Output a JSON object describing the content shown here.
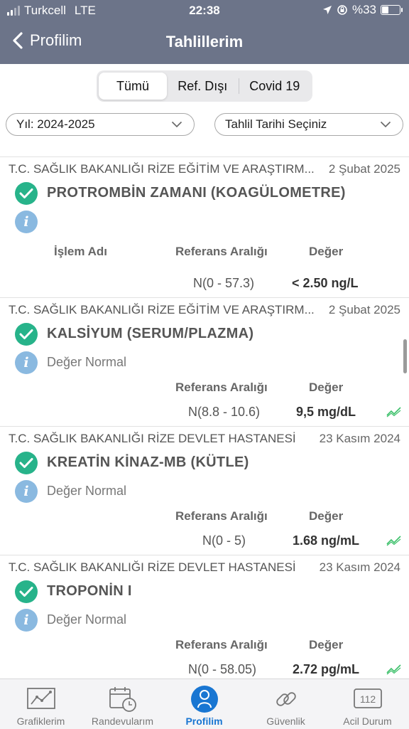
{
  "status_bar": {
    "carrier": "Turkcell",
    "network": "LTE",
    "time": "22:38",
    "battery": "%33",
    "battery_level": 0.33
  },
  "nav": {
    "back_label": "Profilim",
    "title": "Tahlillerim"
  },
  "segments": [
    "Tümü",
    "Ref. Dışı",
    "Covid 19"
  ],
  "filters": {
    "year": "Yıl: 2024-2025",
    "date": "Tahlil Tarihi Seçiniz"
  },
  "columns": {
    "name": "İşlem Adı",
    "range": "Referans Aralığı",
    "value": "Değer"
  },
  "results": [
    {
      "hospital": "T.C. SAĞLIK BAKANLIĞI RİZE EĞİTİM VE ARAŞTIRM...",
      "date": "2 Şubat 2025",
      "test": "PROTROMBİN ZAMANI (KOAGÜLOMETRE)",
      "status": "",
      "range": "N(0 - 57.3)",
      "value": "< 2.50 ng/L"
    },
    {
      "hospital": "T.C. SAĞLIK BAKANLIĞI RİZE EĞİTİM VE ARAŞTIRM...",
      "date": "2 Şubat 2025",
      "test": "KALSİYUM (SERUM/PLAZMA)",
      "status": "Değer Normal",
      "range": "N(8.8 - 10.6)",
      "value": "9,5 mg/dL"
    },
    {
      "hospital": "T.C. SAĞLIK BAKANLIĞI RİZE DEVLET HASTANESİ",
      "date": "23 Kasım 2024",
      "test": "KREATİN KİNAZ-MB (KÜTLE)",
      "status": "Değer Normal",
      "range": "N(0 - 5)",
      "value": "1.68 ng/mL"
    },
    {
      "hospital": "T.C. SAĞLIK BAKANLIĞI RİZE DEVLET HASTANESİ",
      "date": "23 Kasım 2024",
      "test": "TROPONİN I",
      "status": "Değer Normal",
      "range": "N(0 - 58.05)",
      "value": "2.72 pg/mL"
    }
  ],
  "tabs": [
    {
      "label": "Grafiklerim",
      "icon": "chart-icon"
    },
    {
      "label": "Randevularım",
      "icon": "calendar-clock-icon"
    },
    {
      "label": "Profilim",
      "icon": "person-icon"
    },
    {
      "label": "Güvenlik",
      "icon": "link-icon"
    },
    {
      "label": "Acil Durum",
      "icon": "emergency-112-icon",
      "badge": "112"
    }
  ],
  "colors": {
    "header": "#6c7489",
    "check": "#27b38a",
    "info": "#8ab9e0",
    "active_tab": "#1976d2",
    "trend": "#3cc06a"
  }
}
